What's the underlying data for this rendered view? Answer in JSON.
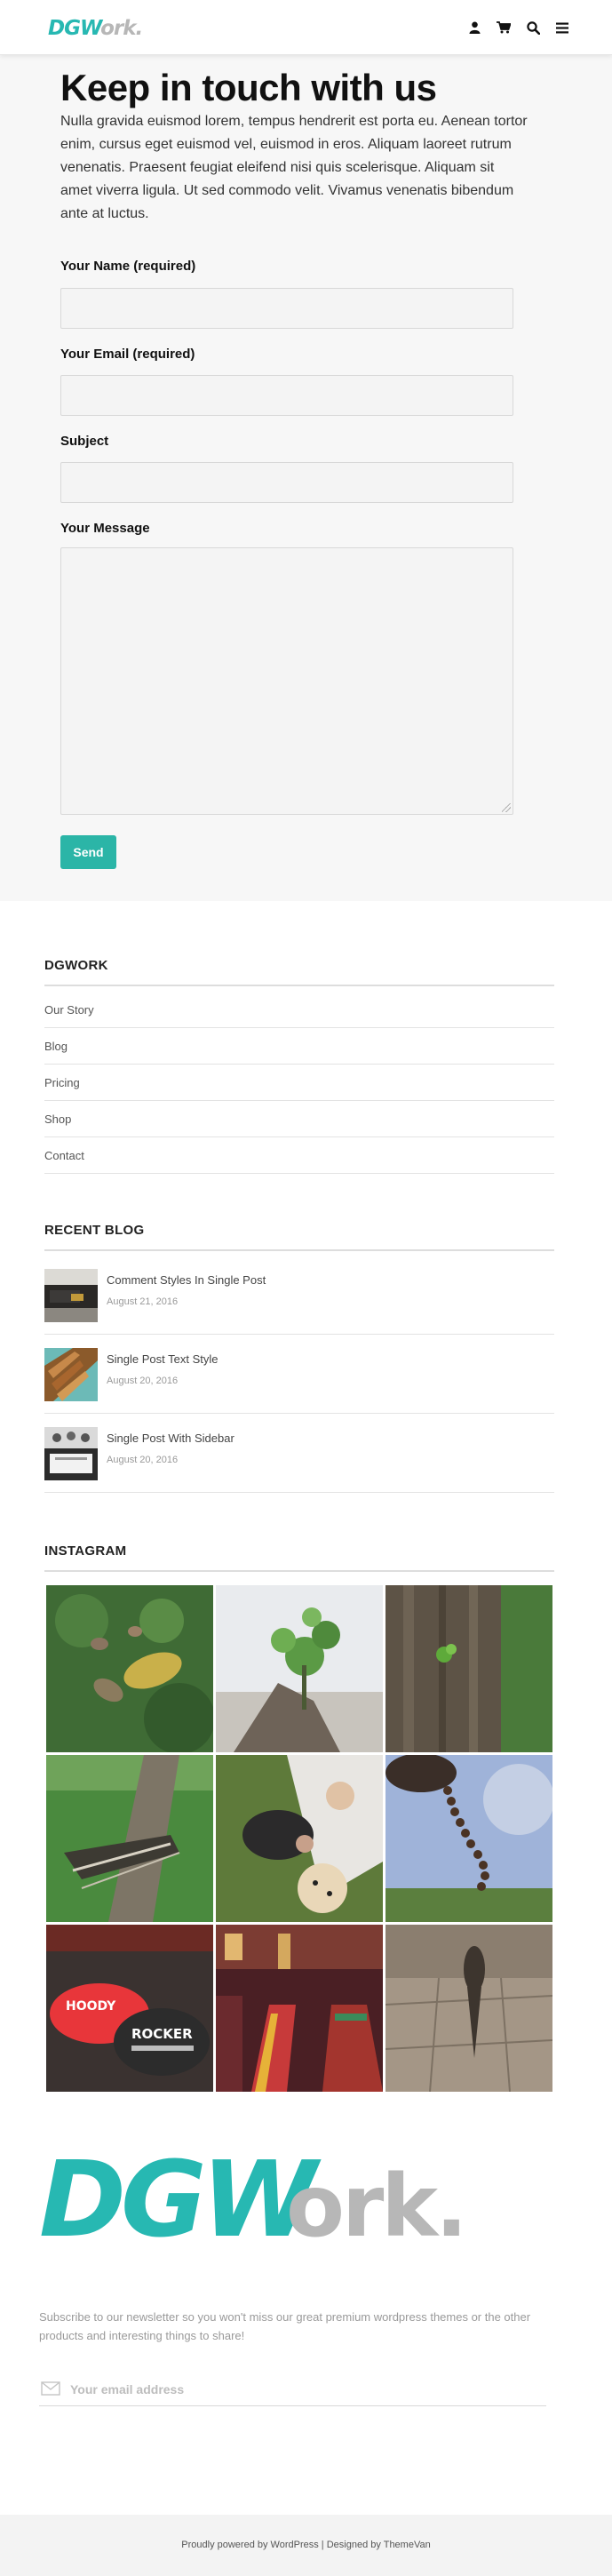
{
  "header": {
    "logo_dgw": "DGW",
    "logo_ork": "ork.",
    "icons": [
      "user-icon",
      "cart-icon",
      "search-icon",
      "menu-icon"
    ]
  },
  "contact": {
    "title": "Keep in touch with us",
    "intro": "Nulla gravida euismod lorem, tempus hendrerit est porta eu. Aenean tortor enim, cursus eget euismod vel, euismod in eros. Aliquam laoreet rutrum venenatis. Praesent feugiat eleifend nisi quis scelerisque. Aliquam sit amet viverra ligula. Ut sed commodo velit. Vivamus venenatis bibendum ante at luctus.",
    "name_label": "Your Name (required)",
    "email_label": "Your Email (required)",
    "subject_label": "Subject",
    "message_label": "Your Message",
    "send_label": "Send"
  },
  "dgwork_widget": {
    "title": "DGWORK",
    "items": [
      "Our Story",
      "Blog",
      "Pricing",
      "Shop",
      "Contact"
    ]
  },
  "recent_blog": {
    "title": "RECENT BLOG",
    "posts": [
      {
        "title": "Comment Styles In Single Post",
        "date": "August 21, 2016"
      },
      {
        "title": "Single Post Text Style",
        "date": "August 20, 2016"
      },
      {
        "title": "Single Post With Sidebar",
        "date": "August 20, 2016"
      }
    ]
  },
  "instagram": {
    "title": "INSTAGRAM",
    "photos": [
      "leaves-on-grass",
      "young-tree-sapling",
      "tree-bark-moss",
      "bark-on-grass",
      "family-picnic",
      "prayer-beads-sky",
      "caps-on-shelf",
      "restaurant-seats",
      "shadow-on-pavement"
    ]
  },
  "footer": {
    "logo_dgw": "DGW",
    "logo_ork": "ork.",
    "subscribe_text": "Subscribe to our newsletter so you won't miss our great premium wordpress themes or the other products and interesting things to share!",
    "email_placeholder": "Your email address",
    "credits": "Proudly powered by WordPress | Designed by ThemeVan"
  },
  "colors": {
    "accent": "#27b8b2",
    "send_button": "#2bb5a7",
    "logo_grey": "#b7b7b7"
  }
}
